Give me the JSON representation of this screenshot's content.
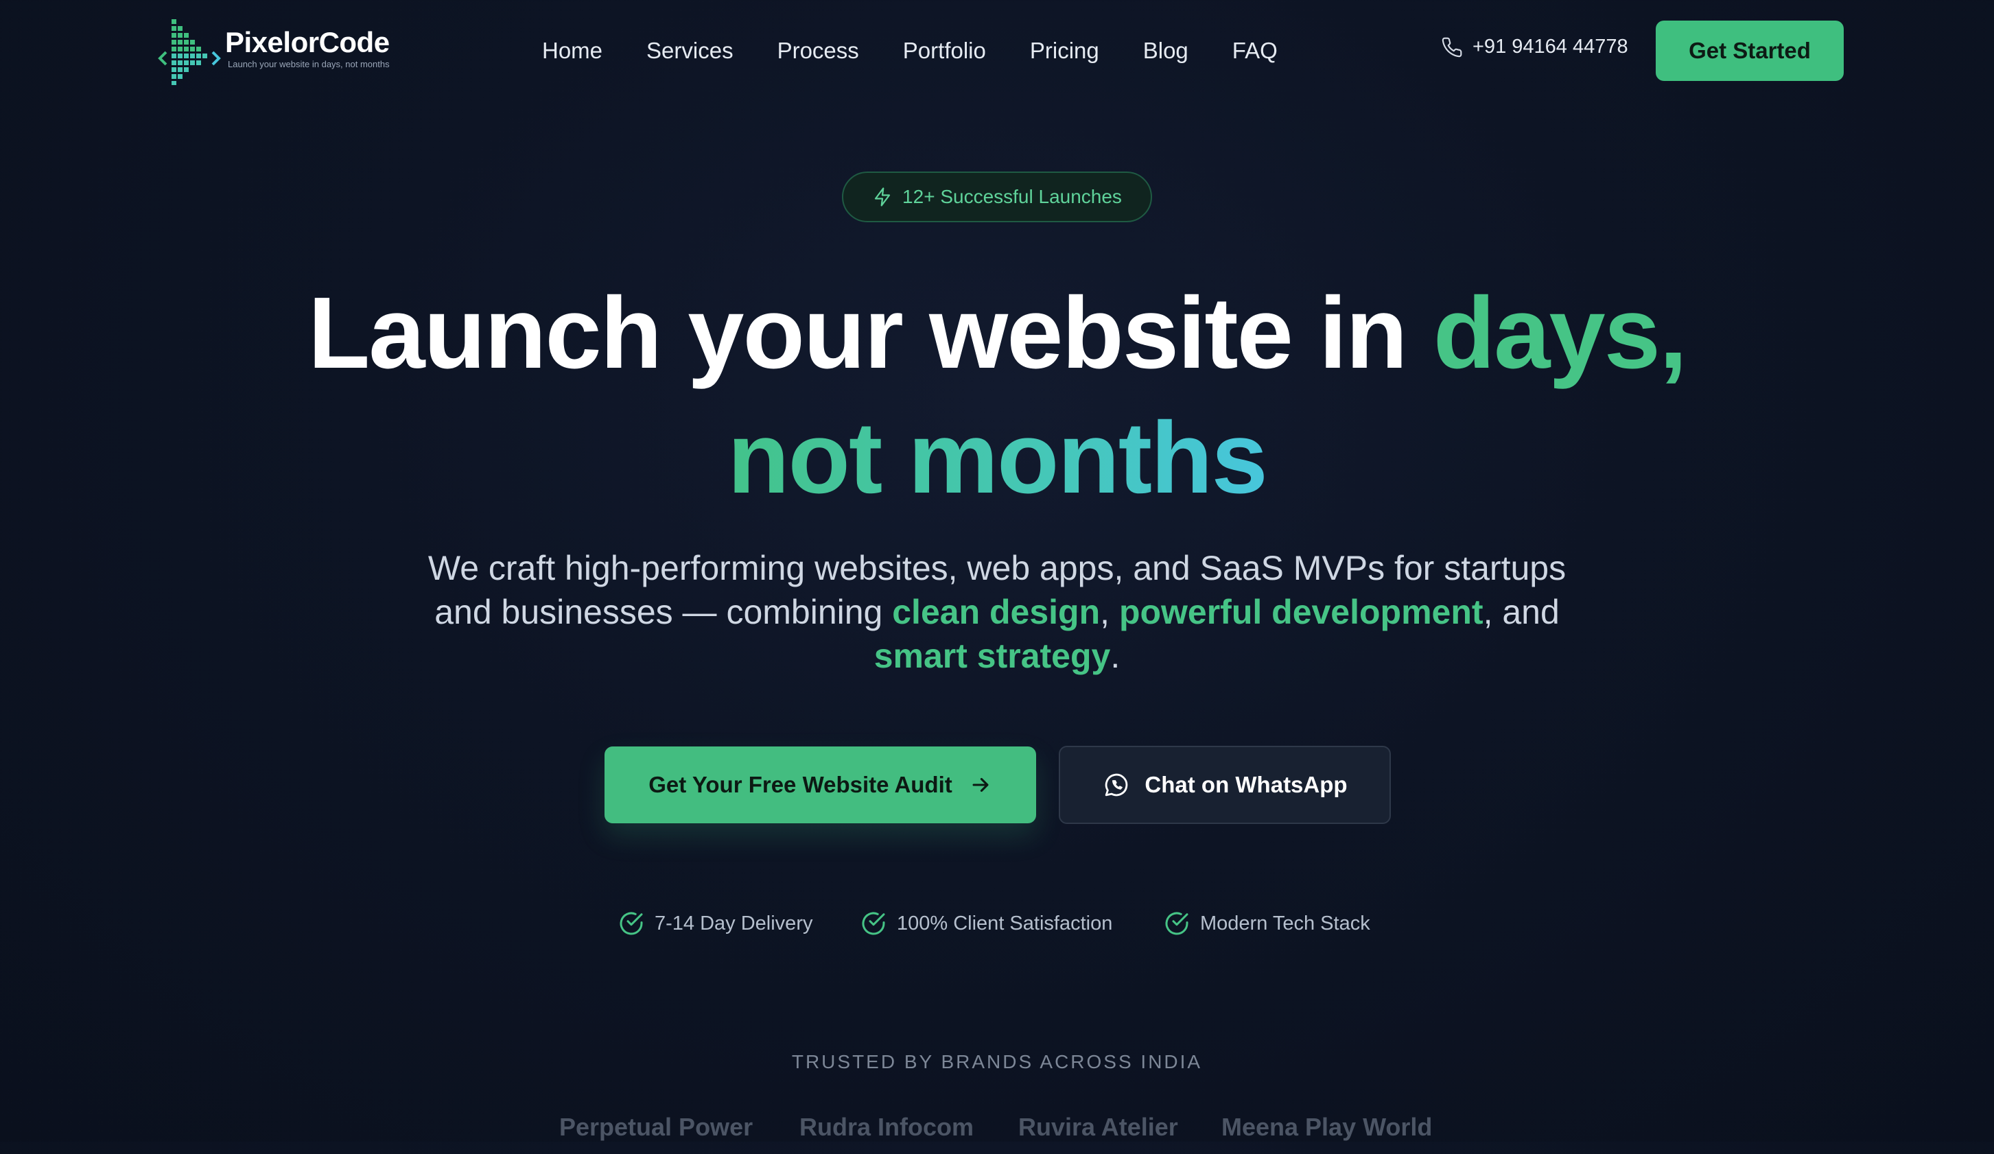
{
  "nav": {
    "logo_name": "PixelorCode",
    "logo_tagline": "Launch your website in days, not months",
    "links": [
      "Home",
      "Services",
      "Process",
      "Portfolio",
      "Pricing",
      "Blog",
      "FAQ"
    ],
    "phone": "+91 94164 44778",
    "cta": "Get Started"
  },
  "hero": {
    "badge": "12+ Successful Launches",
    "headline_part1": "Launch your website in ",
    "headline_highlight": "days,",
    "headline_line2": "not months",
    "subtitle_part1": "We craft high-performing websites, web apps, and SaaS MVPs for startups and businesses — combining ",
    "subtitle_hl1": "clean design",
    "subtitle_sep1": ", ",
    "subtitle_hl2": "powerful development",
    "subtitle_sep2": ", and ",
    "subtitle_hl3": "smart strategy",
    "subtitle_end": ".",
    "cta_primary": "Get Your Free Website Audit",
    "cta_secondary": "Chat on WhatsApp",
    "checks": [
      "7-14 Day Delivery",
      "100% Client Satisfaction",
      "Modern Tech Stack"
    ]
  },
  "trusted": {
    "label": "TRUSTED BY BRANDS ACROSS INDIA",
    "brands": [
      "Perpetual Power",
      "Rudra Infocom",
      "Ruvira Atelier",
      "Meena Play World"
    ]
  },
  "colors": {
    "accent": "#3fbf7f",
    "background": "#0d1424",
    "gradient_end": "#47c6dc"
  },
  "icons": {
    "phone": "phone-icon",
    "badge": "lightning-icon",
    "arrow": "arrow-right-icon",
    "whatsapp": "whatsapp-icon",
    "check": "check-circle-icon"
  }
}
